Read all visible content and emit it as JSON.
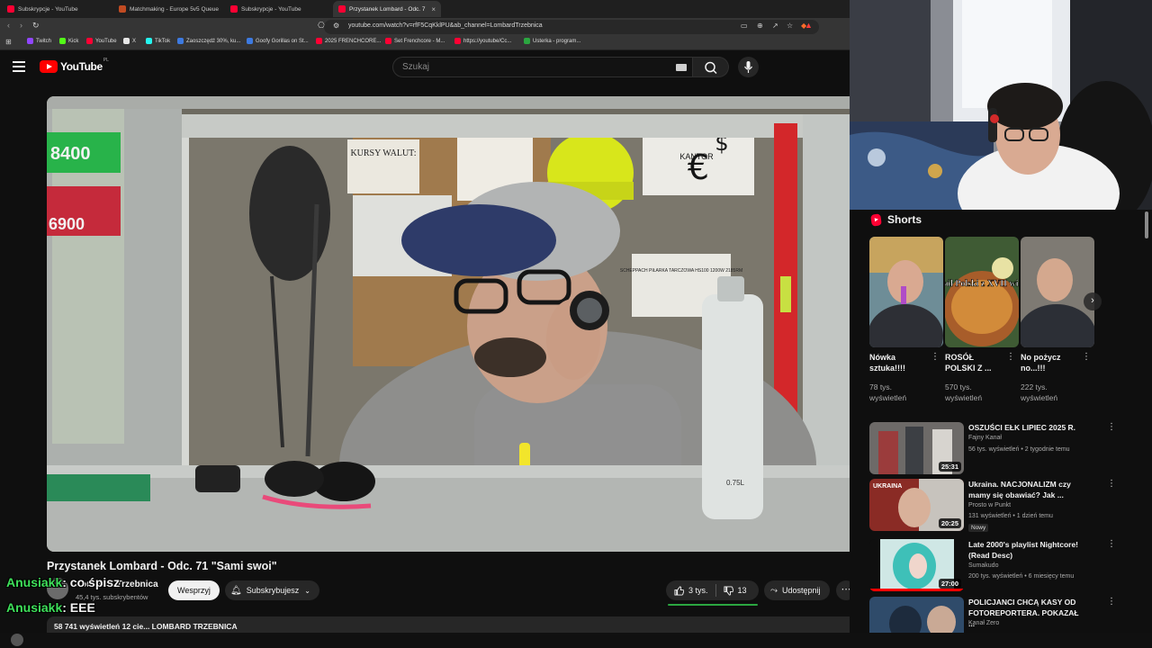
{
  "browser": {
    "tabs": [
      {
        "title": "Subskrypcje - YouTube",
        "favicon_color": "#ff0033",
        "active": false
      },
      {
        "title": "Matchmaking - Europe 5v5 Queue",
        "favicon_color": "#c14b22",
        "active": false
      },
      {
        "title": "Subskrypcje - YouTube",
        "favicon_color": "#ff0033",
        "active": false
      },
      {
        "title": "Przystanek Lombard - Odc. 7",
        "favicon_color": "#ff0033",
        "active": true
      }
    ],
    "url": "youtube.com/watch?v=rfF5CqKklPU&ab_channel=LombardTrzebnica",
    "bookmarks": [
      {
        "label": "Twitch",
        "color": "#9146ff"
      },
      {
        "label": "Kick",
        "color": "#53fc18"
      },
      {
        "label": "YouTube",
        "color": "#ff0033"
      },
      {
        "label": "X",
        "color": "#e6e6e6"
      },
      {
        "label": "TikTok",
        "color": "#25f4ee"
      },
      {
        "label": "Zaoszczędź 30%, ku...",
        "color": "#3d7ae0"
      },
      {
        "label": "Goofy Gorillas on St...",
        "color": "#3d7ae0"
      },
      {
        "label": "2025 FRENCHCORE...",
        "color": "#ff0033"
      },
      {
        "label": "Set Frenchcore - M...",
        "color": "#ff0033"
      },
      {
        "label": "https://youtube/Cc...",
        "color": "#ff0033"
      },
      {
        "label": "Usterka - program...",
        "color": "#2ba640"
      }
    ]
  },
  "masthead": {
    "logo_text": "YouTube",
    "region": "PL",
    "search_placeholder": "Szukaj"
  },
  "video": {
    "title": "Przystanek Lombard - Odc. 71 \"Sami swoi\"",
    "channel": "Lombard Trzebnica",
    "subscribers": "45,4 tys. subskrybentów",
    "support_label": "Wesprzyj",
    "subscribe_label": "Subskrybujesz",
    "likes": "3 tys.",
    "dislikes": "13",
    "share_label": "Udostępnij",
    "stats": "58 741 wyświetleń  12 cie...  LOMBARD TRZEBNICA",
    "scene_text": {
      "kursy": "KURSY WALUT:",
      "kantor": "KANTOR",
      "saw_sign": "SCHEPPACH PIŁARKA TARCZOWA HS100 1200W 2185RM",
      "bottle": "0.75L",
      "price1": "8400",
      "price2": "6900"
    }
  },
  "shorts": {
    "heading": "Shorts",
    "items": [
      {
        "title": "Nówka sztuka!!!!",
        "views": "78 tys. wyświetleń"
      },
      {
        "title": "ROSÓŁ POLSKI Z ...",
        "views": "570 tys. wyświetleń",
        "overlay": "Rosół Polski z XVII wieku"
      },
      {
        "title": "No pożycz no...!!!",
        "views": "222 tys. wyświetleń"
      }
    ]
  },
  "recommendations": [
    {
      "title": "OSZUŚCI EŁK LIPIEC 2025 R.",
      "channel": "Fajny Kanał",
      "meta": "56 tys. wyświetleń • 2 tygodnie temu",
      "duration": "25:31"
    },
    {
      "title": "Ukraina. NACJONALIZM czy mamy się obawiać? Jak ...",
      "channel": "Prosto w Punkt",
      "meta": "131 wyświetleń • 1 dzień temu",
      "duration": "20:25",
      "badge": "Nowy",
      "thumb_label": "UKRAINA"
    },
    {
      "title": "Late 2000's playlist Nightcore! (Read Desc)",
      "channel": "Sumakudo",
      "meta": "200 tys. wyświetleń • 6 miesięcy temu",
      "duration": "27:00"
    },
    {
      "title": "POLICJANCI CHCĄ KASY OD FOTOREPORTERA. POKAZAŁ ...",
      "channel": "Kanał Zero",
      "meta": "",
      "duration": ""
    }
  ],
  "chat": [
    {
      "user": "Anusiakk",
      "text": ": co śpisz"
    },
    {
      "user": "Anusiakk",
      "text": ": EEE"
    }
  ],
  "colors": {
    "accent": "#ff0000",
    "like_bar": "#2ba640",
    "chat_user": "#3ee05a",
    "background": "#0f0f0f"
  }
}
